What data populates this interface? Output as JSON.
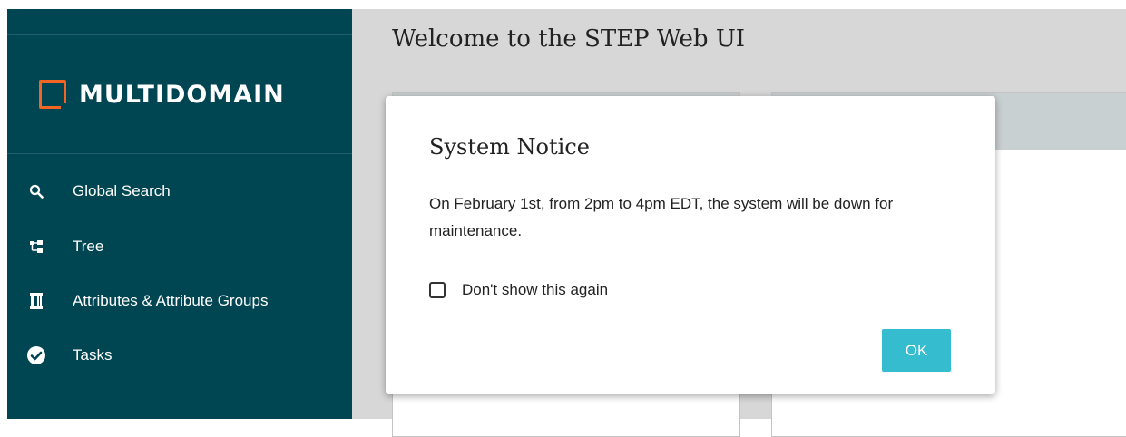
{
  "sidebar": {
    "logo_text": "MULTIDOMAIN",
    "items": [
      {
        "label": "Global Search",
        "icon": "search-icon"
      },
      {
        "label": "Tree",
        "icon": "tree-icon"
      },
      {
        "label": "Attributes & Attribute Groups",
        "icon": "attribute-icon"
      },
      {
        "label": "Tasks",
        "icon": "check-circle-icon"
      }
    ]
  },
  "main": {
    "title": "Welcome to the STEP Web UI"
  },
  "modal": {
    "title": "System Notice",
    "message": "On February 1st, from 2pm to 4pm EDT, the system will be down for maintenance.",
    "checkbox_label": "Don't show this again",
    "checkbox_checked": false,
    "ok_label": "OK"
  },
  "colors": {
    "sidebar_bg": "#004552",
    "logo_accent": "#f26522",
    "ok_button": "#35bccf",
    "main_bg": "#d7d7d7"
  }
}
